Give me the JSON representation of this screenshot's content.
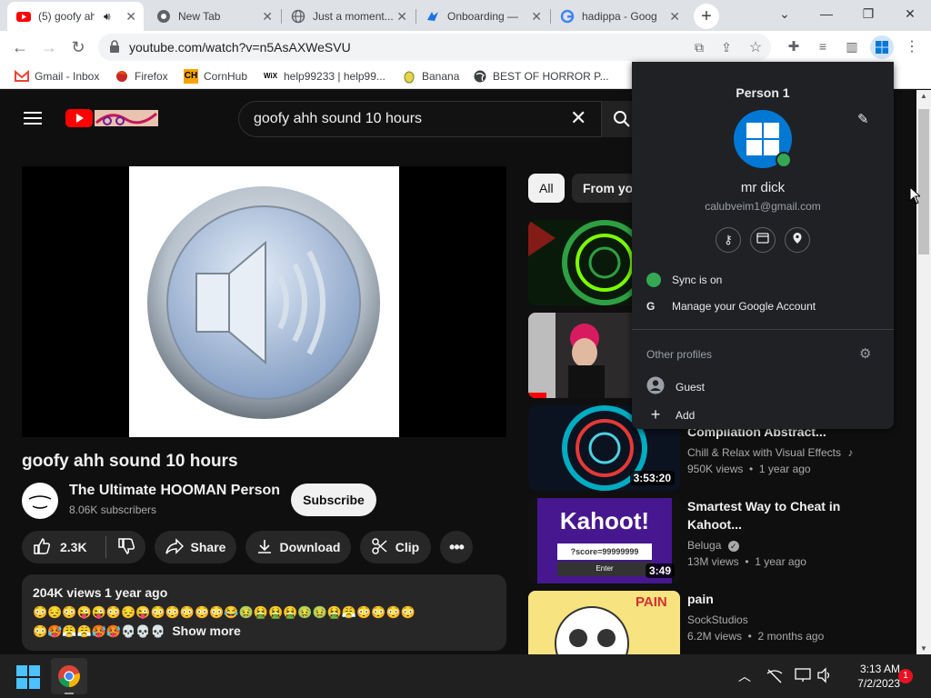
{
  "browser": {
    "tabs": [
      {
        "label": "(5) goofy ahh",
        "active": true,
        "icon": "youtube-icon"
      },
      {
        "label": "New Tab",
        "active": false,
        "icon": "chrome-icon"
      },
      {
        "label": "Just a moment...",
        "active": false,
        "icon": "globe-icon"
      },
      {
        "label": "Onboarding —",
        "active": false,
        "icon": "onboarding-icon"
      },
      {
        "label": "hadippa - Goog",
        "active": false,
        "icon": "google-icon"
      }
    ],
    "url": "youtube.com/watch?v=n5AsAXWeSVU",
    "bookmarks": [
      {
        "label": "Gmail - Inbox",
        "icon": "gmail-icon"
      },
      {
        "label": "Firefox",
        "icon": "firefox-icon"
      },
      {
        "label": "CornHub",
        "icon": "cornhub-icon"
      },
      {
        "label": "help99233 | help99...",
        "icon": "wix-icon"
      },
      {
        "label": "Banana",
        "icon": "banana-icon"
      },
      {
        "label": "BEST OF HORROR P...",
        "icon": "globe-icon"
      }
    ],
    "cornhub_icon_text": "CH",
    "wix_icon_text": "WiX"
  },
  "youtube": {
    "search_value": "goofy ahh sound 10 hours",
    "video_title": "goofy ahh sound 10 hours",
    "channel_name": "The Ultimate HOOMAN Person",
    "subscribers": "8.06K subscribers",
    "subscribe_label": "Subscribe",
    "likes": "2.3K",
    "share_label": "Share",
    "download_label": "Download",
    "clip_label": "Clip",
    "description": {
      "views": "204K views",
      "age": "1 year ago",
      "emoji_line1": "😳😔😳😜😜😳😔😜😳😳😳😳😳😂🤢🤮🤮🤮🤢🤢🤮😤😳😳😳😳",
      "emoji_line2": "😳🥵😤😤🥵🥵💀💀💀",
      "show_more": "Show more"
    },
    "chips": [
      "All",
      "From you"
    ],
    "related": [
      {
        "title": "Compilation Abstract...",
        "channel": "Chill & Relax with Visual Effects",
        "meta": "950K views  •  1 year ago",
        "duration": "3:53:20",
        "music_note": "♪"
      },
      {
        "title": "Smartest Way to Cheat in Kahoot...",
        "channel": "Beluga",
        "meta": "13M views  •  1 year ago",
        "duration": "3:49",
        "verified": "✓"
      },
      {
        "title": "pain",
        "channel": "SockStudios",
        "meta": "6.2M views  •  2 months ago"
      }
    ],
    "kahoot_thumb": {
      "title": "Kahoot!",
      "field": "?score=99999999",
      "enter": "Enter"
    },
    "pain_thumb_text": "PAIN"
  },
  "profile_menu": {
    "title": "Person 1",
    "name": "mr dick",
    "email": "calubveim1@gmail.com",
    "sync": "Sync is on",
    "manage": "Manage your Google Account",
    "other_profiles": "Other profiles",
    "guest": "Guest",
    "add": "Add",
    "google_letter": "G"
  },
  "taskbar": {
    "time": "3:13 AM",
    "date": "7/2/2023",
    "notification_count": "1"
  },
  "colors": {
    "accent_blue": "#1a73e8",
    "youtube_red": "#ff0000",
    "sync_green": "#34a853",
    "windows_blue": "#0078d4"
  }
}
